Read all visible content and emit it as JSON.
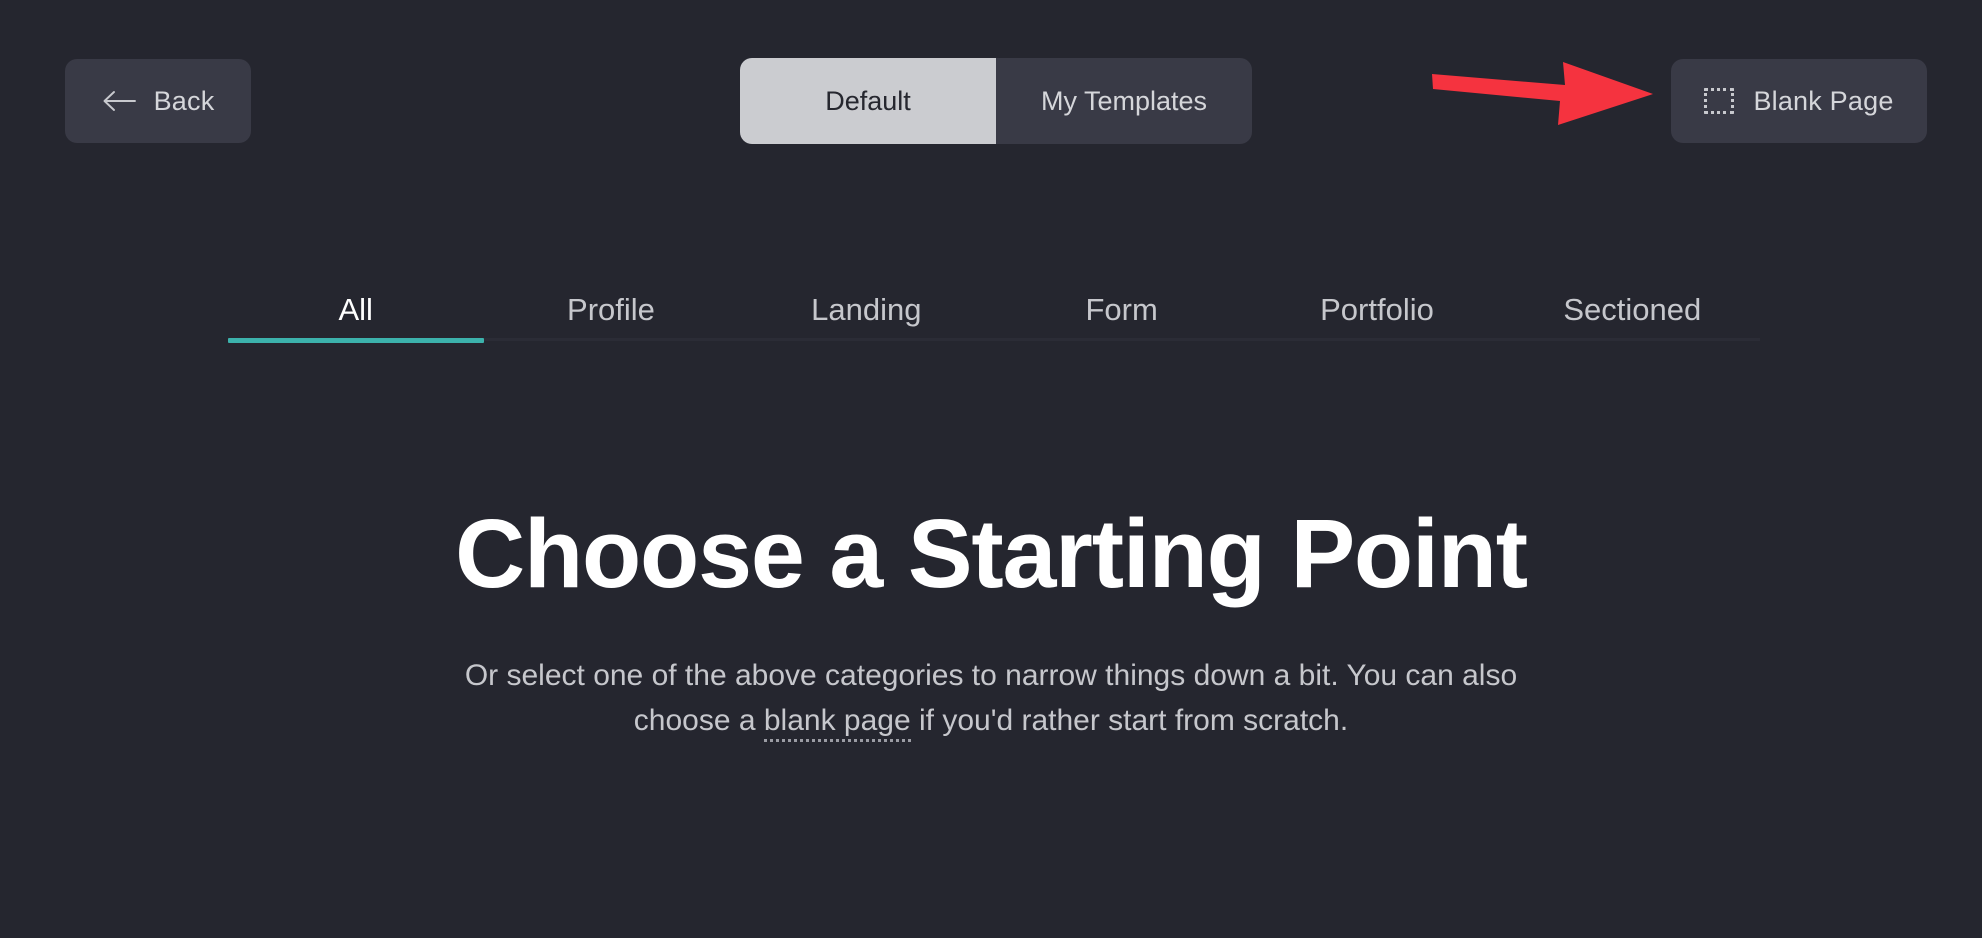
{
  "header": {
    "back_button": {
      "label": "Back",
      "icon": "arrow-left-icon"
    },
    "view_toggle": {
      "options": [
        {
          "label": "Default",
          "active": true
        },
        {
          "label": "My Templates",
          "active": false
        }
      ]
    },
    "blank_page_button": {
      "label": "Blank Page",
      "icon": "dashed-square-icon"
    },
    "annotation": {
      "type": "pointer-arrow",
      "direction": "right",
      "color": "#f5333f",
      "points_to": "Blank Page"
    }
  },
  "tabs": {
    "items": [
      {
        "label": "All",
        "active": true
      },
      {
        "label": "Profile",
        "active": false
      },
      {
        "label": "Landing",
        "active": false
      },
      {
        "label": "Form",
        "active": false
      },
      {
        "label": "Portfolio",
        "active": false
      },
      {
        "label": "Sectioned",
        "active": false
      }
    ],
    "indicator_color": "#3cb2ac"
  },
  "main": {
    "headline": "Choose a Starting Point",
    "subtitle_before": "Or select one of the above categories to narrow things down a bit. You can also choose a ",
    "subtitle_link": "blank page",
    "subtitle_after": " if you'd rather start from scratch."
  },
  "colors": {
    "background": "#25262f",
    "surface": "#393a46",
    "accent_teal": "#3cb2ac",
    "accent_red": "#f5333f",
    "active_segment": "#cbccd0",
    "text_primary": "#ffffff",
    "text_secondary": "#c6c7cc"
  }
}
